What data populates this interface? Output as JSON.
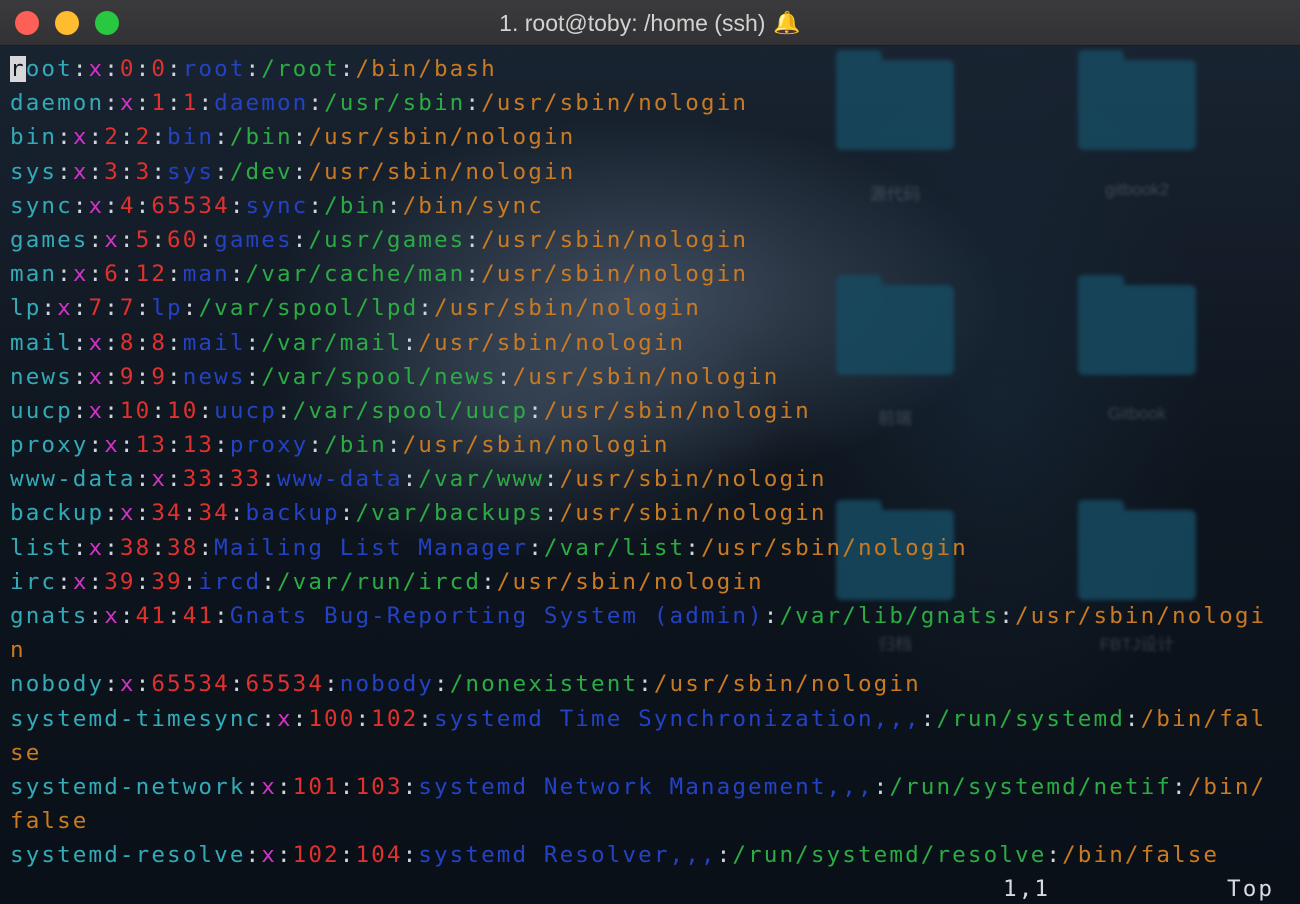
{
  "window": {
    "title": "1. root@toby: /home (ssh)",
    "bell_icon": "bell-icon"
  },
  "desktop": {
    "folders": [
      {
        "label": "源代码"
      },
      {
        "label": "gitbook2"
      },
      {
        "label": "前端"
      },
      {
        "label": "Gitbook"
      },
      {
        "label": "归档"
      },
      {
        "label": "FBTJ设计"
      }
    ]
  },
  "colors": {
    "username": "#33aab7",
    "password": "#d232c8",
    "ids": "#e0312d",
    "gecos": "#2342c4",
    "home": "#2cab44",
    "shell": "#c97a22",
    "separator": "#cfd6dd"
  },
  "terminal": {
    "rows": [
      {
        "u": "root",
        "p": "x",
        "uid": "0",
        "gid": "0",
        "g": "root",
        "h": "/root",
        "s": "/bin/bash"
      },
      {
        "u": "daemon",
        "p": "x",
        "uid": "1",
        "gid": "1",
        "g": "daemon",
        "h": "/usr/sbin",
        "s": "/usr/sbin/nologin"
      },
      {
        "u": "bin",
        "p": "x",
        "uid": "2",
        "gid": "2",
        "g": "bin",
        "h": "/bin",
        "s": "/usr/sbin/nologin"
      },
      {
        "u": "sys",
        "p": "x",
        "uid": "3",
        "gid": "3",
        "g": "sys",
        "h": "/dev",
        "s": "/usr/sbin/nologin"
      },
      {
        "u": "sync",
        "p": "x",
        "uid": "4",
        "gid": "65534",
        "g": "sync",
        "h": "/bin",
        "s": "/bin/sync"
      },
      {
        "u": "games",
        "p": "x",
        "uid": "5",
        "gid": "60",
        "g": "games",
        "h": "/usr/games",
        "s": "/usr/sbin/nologin"
      },
      {
        "u": "man",
        "p": "x",
        "uid": "6",
        "gid": "12",
        "g": "man",
        "h": "/var/cache/man",
        "s": "/usr/sbin/nologin"
      },
      {
        "u": "lp",
        "p": "x",
        "uid": "7",
        "gid": "7",
        "g": "lp",
        "h": "/var/spool/lpd",
        "s": "/usr/sbin/nologin"
      },
      {
        "u": "mail",
        "p": "x",
        "uid": "8",
        "gid": "8",
        "g": "mail",
        "h": "/var/mail",
        "s": "/usr/sbin/nologin"
      },
      {
        "u": "news",
        "p": "x",
        "uid": "9",
        "gid": "9",
        "g": "news",
        "h": "/var/spool/news",
        "s": "/usr/sbin/nologin"
      },
      {
        "u": "uucp",
        "p": "x",
        "uid": "10",
        "gid": "10",
        "g": "uucp",
        "h": "/var/spool/uucp",
        "s": "/usr/sbin/nologin"
      },
      {
        "u": "proxy",
        "p": "x",
        "uid": "13",
        "gid": "13",
        "g": "proxy",
        "h": "/bin",
        "s": "/usr/sbin/nologin"
      },
      {
        "u": "www-data",
        "p": "x",
        "uid": "33",
        "gid": "33",
        "g": "www-data",
        "h": "/var/www",
        "s": "/usr/sbin/nologin"
      },
      {
        "u": "backup",
        "p": "x",
        "uid": "34",
        "gid": "34",
        "g": "backup",
        "h": "/var/backups",
        "s": "/usr/sbin/nologin"
      },
      {
        "u": "list",
        "p": "x",
        "uid": "38",
        "gid": "38",
        "g": "Mailing List Manager",
        "h": "/var/list",
        "s": "/usr/sbin/nologin"
      },
      {
        "u": "irc",
        "p": "x",
        "uid": "39",
        "gid": "39",
        "g": "ircd",
        "h": "/var/run/ircd",
        "s": "/usr/sbin/nologin"
      },
      {
        "u": "gnats",
        "p": "x",
        "uid": "41",
        "gid": "41",
        "g": "Gnats Bug-Reporting System (admin)",
        "h": "/var/lib/gnats",
        "s": "/usr/sbin/nologin"
      },
      {
        "u": "nobody",
        "p": "x",
        "uid": "65534",
        "gid": "65534",
        "g": "nobody",
        "h": "/nonexistent",
        "s": "/usr/sbin/nologin"
      },
      {
        "u": "systemd-timesync",
        "p": "x",
        "uid": "100",
        "gid": "102",
        "g": "systemd Time Synchronization,,,",
        "h": "/run/systemd",
        "s": "/bin/false"
      },
      {
        "u": "systemd-network",
        "p": "x",
        "uid": "101",
        "gid": "103",
        "g": "systemd Network Management,,,",
        "h": "/run/systemd/netif",
        "s": "/bin/false"
      },
      {
        "u": "systemd-resolve",
        "p": "x",
        "uid": "102",
        "gid": "104",
        "g": "systemd Resolver,,,",
        "h": "/run/systemd/resolve",
        "s": "/bin/false"
      }
    ]
  },
  "status": {
    "position": "1,1",
    "scroll": "Top"
  }
}
